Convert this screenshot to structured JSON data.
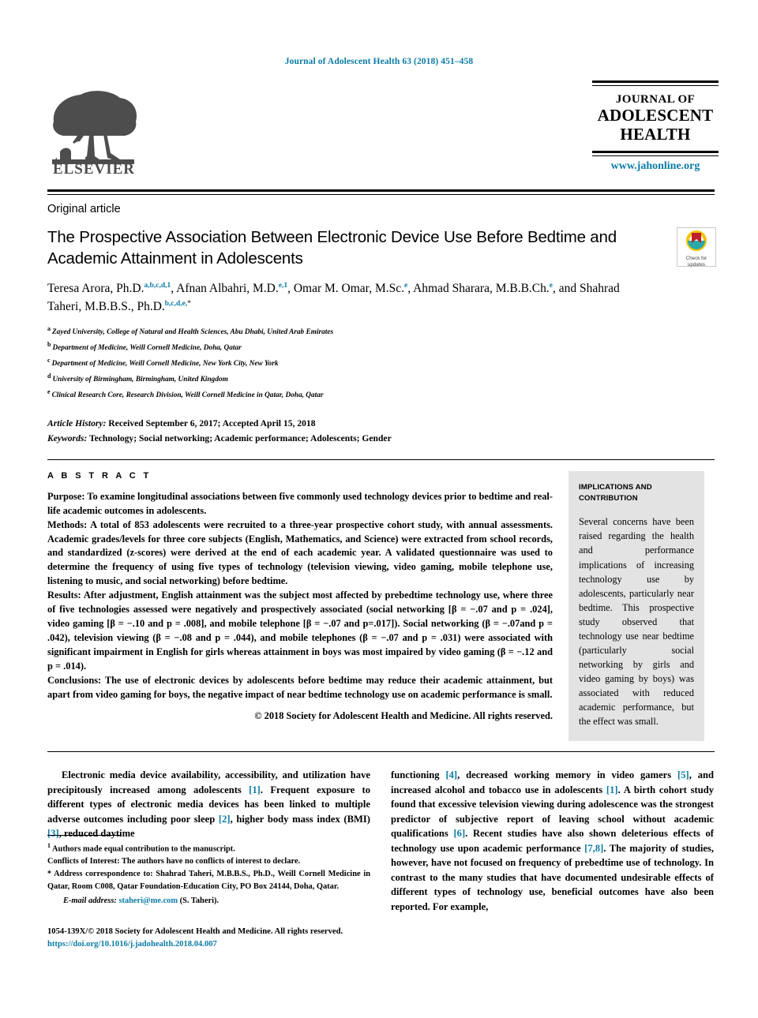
{
  "running_head": "Journal of Adolescent Health 63 (2018) 451–458",
  "publisher": {
    "name": "ELSEVIER",
    "logo_icon": "elsevier-tree-logo"
  },
  "journal_logo": {
    "line1": "JOURNAL OF",
    "line2": "ADOLESCENT",
    "line3": "HEALTH",
    "url": "www.jahonline.org"
  },
  "crossmark": {
    "line1": "Check for",
    "line2": "updates",
    "icon": "crossmark-badge-icon"
  },
  "article_type": "Original article",
  "title": "The Prospective Association Between Electronic Device Use Before Bedtime and Academic Attainment in Adolescents",
  "authors": [
    {
      "name": "Teresa Arora, Ph.D.",
      "marks": "a,b,c,d,1",
      "sep": ", "
    },
    {
      "name": "Afnan Albahri, M.D.",
      "marks": "e,1",
      "sep": ", "
    },
    {
      "name": "Omar M. Omar, M.Sc.",
      "marks": "e",
      "sep": ", "
    },
    {
      "name": "Ahmad Sharara, M.B.B.Ch.",
      "marks": "e",
      "sep": ", and "
    },
    {
      "name": "Shahrad Taheri, M.B.B.S., Ph.D.",
      "marks": "b,c,d,e,",
      "star": "*",
      "sep": ""
    }
  ],
  "affiliations": [
    {
      "mark": "a",
      "text": "Zayed University, College of Natural and Health Sciences, Abu Dhabi, United Arab Emirates"
    },
    {
      "mark": "b",
      "text": "Department of Medicine, Weill Cornell Medicine, Doha, Qatar"
    },
    {
      "mark": "c",
      "text": "Department of Medicine, Weill Cornell Medicine, New York City, New York"
    },
    {
      "mark": "d",
      "text": "University of Birmingham, Birmingham, United Kingdom"
    },
    {
      "mark": "e",
      "text": "Clinical Research Core, Research Division, Weill Cornell Medicine in Qatar, Doha, Qatar"
    }
  ],
  "history": {
    "label": "Article History:",
    "text": "Received September 6, 2017; Accepted April 15, 2018"
  },
  "keywords": {
    "label": "Keywords:",
    "text": "Technology; Social networking; Academic performance; Adolescents; Gender"
  },
  "abstract": {
    "heading": "A B S T R A C T",
    "sections": [
      {
        "label": "Purpose:",
        "text": " To examine longitudinal associations between five commonly used technology devices prior to bedtime and real-life academic outcomes in adolescents."
      },
      {
        "label": "Methods:",
        "text": " A total of 853 adolescents were recruited to a three-year prospective cohort study, with annual assessments. Academic grades/levels for three core subjects (English, Mathematics, and Science) were extracted from school records, and standardized (z-scores) were derived at the end of each academic year. A validated questionnaire was used to determine the frequency of using five types of technology (television viewing, video gaming, mobile telephone use, listening to music, and social networking) before bedtime."
      },
      {
        "label": "Results:",
        "text": " After adjustment, English attainment was the subject most affected by prebedtime technology use, where three of five technologies assessed were negatively and prospectively associated (social networking [β = −.07 and p = .024], video gaming [β = −.10 and p = .008], and mobile telephone [β = −.07 and p=.017]). Social networking (β = −.07and p = .042), television viewing (β = −.08 and p = .044), and mobile telephones (β = −.07 and p = .031) were associated with significant impairment in English for girls whereas attainment in boys was most impaired by video gaming (β = −.12 and p = .014)."
      },
      {
        "label": "Conclusions:",
        "text": " The use of electronic devices by adolescents before bedtime may reduce their academic attainment, but apart from video gaming for boys, the negative impact of near bedtime technology use on academic performance is small."
      }
    ],
    "copyright": "© 2018 Society for Adolescent Health and Medicine. All rights reserved."
  },
  "implications": {
    "heading": "IMPLICATIONS AND CONTRIBUTION",
    "body": "Several concerns have been raised regarding the health and performance implications of increasing technology use by adolescents, particularly near bedtime. This prospective study observed that technology use near bedtime (particularly social networking by girls and video gaming by boys) was associated with reduced academic performance, but the effect was small."
  },
  "body_columns": {
    "left": "Electronic media device availability, accessibility, and utilization have precipitously increased among adolescents [1]. Frequent exposure to different types of electronic media devices has been linked to multiple adverse outcomes including poor sleep [2], higher body mass index (BMI) [3], reduced daytime",
    "right": "functioning [4], decreased working memory in video gamers [5], and increased alcohol and tobacco use in adolescents [1]. A birth cohort study found that excessive television viewing during adolescence was the strongest predictor of subjective report of leaving school without academic qualifications [6]. Recent studies have also shown deleterious effects of technology use upon academic performance [7,8]. The majority of studies, however, have not focused on frequency of prebedtime use of technology. In contrast to the many studies that have documented undesirable effects of different types of technology use, beneficial outcomes have also been reported. For example,"
  },
  "footnotes": {
    "equal_contribution": "Authors made equal contribution to the manuscript.",
    "conflicts_label": "Conflicts of Interest:",
    "conflicts_text": " The authors have no conflicts of interest to declare.",
    "correspondence": "Address correspondence to: Shahrad Taheri, M.B.B.S., Ph.D., Weill Cornell Medicine in Qatar, Room C008, Qatar Foundation-Education City, PO Box 24144, Doha, Qatar.",
    "email_label": "E-mail address:",
    "email": "staheri@me.com",
    "email_attrib": " (S. Taheri)."
  },
  "issn_line": "1054-139X/© 2018 Society for Adolescent Health and Medicine. All rights reserved.",
  "doi_line": "https://doi.org/10.1016/j.jadohealth.2018.04.007",
  "colors": {
    "accent_blue": "#0b7ba5",
    "sidebar_gray": "#e3e3e3"
  }
}
